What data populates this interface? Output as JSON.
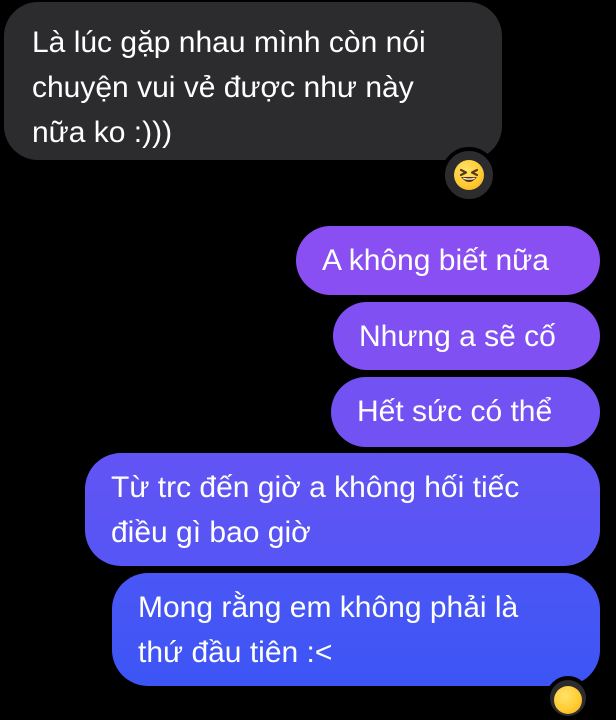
{
  "messages": [
    {
      "direction": "incoming",
      "lines": [
        "Là lúc gặp nhau mình còn nói",
        "chuyện vui vẻ được như này",
        "nữa ko :)))"
      ],
      "reaction_icon": "grinning-squinting-face-icon"
    },
    {
      "direction": "outgoing",
      "lines": [
        "A không biết nữa"
      ]
    },
    {
      "direction": "outgoing",
      "lines": [
        "Nhưng a sẽ cố"
      ]
    },
    {
      "direction": "outgoing",
      "lines": [
        "Hết sức có thể"
      ]
    },
    {
      "direction": "outgoing",
      "lines": [
        "Từ trc đến giờ a không hối tiếc",
        "điều gì bao giờ"
      ]
    },
    {
      "direction": "outgoing",
      "lines": [
        "Mong rằng em không phải là",
        "thứ đầu tiên :<"
      ],
      "reaction_icon": "emoji-reaction-icon"
    }
  ],
  "colors": {
    "background": "#000000",
    "incoming_bubble": "#2c2c2e",
    "outgoing_top": "#8a4ff2",
    "outgoing_bottom": "#3d55f5",
    "text": "#ffffff"
  }
}
